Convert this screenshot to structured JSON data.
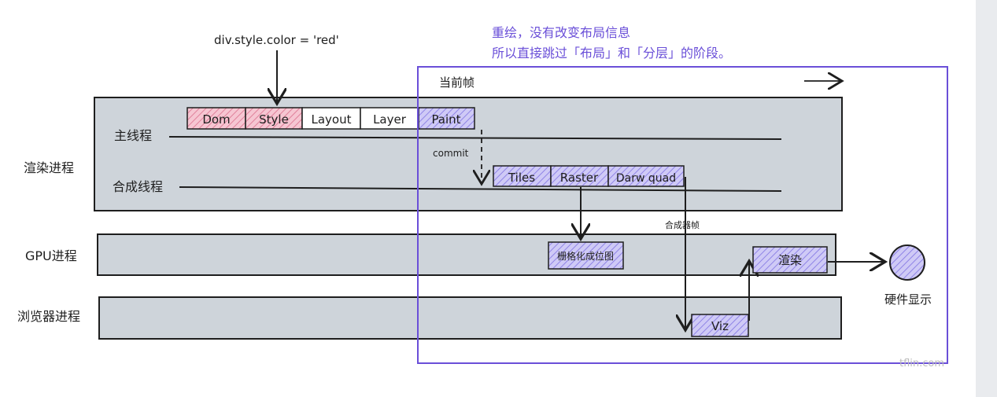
{
  "colors": {
    "lane_fill": "#ced4da",
    "purple": "#6a4fd8",
    "purple_fill": "#b7b0ef",
    "red_fill": "#f1a4b6",
    "stroke": "#1e1e1e"
  },
  "annotations": {
    "code": "div.style.color = 'red'",
    "note_line1": "重绘，没有改变布局信息",
    "note_line2": "所以直接跳过「布局」和「分层」的阶段。",
    "current_frame": "当前帧",
    "commit": "commit",
    "compositor_frame": "合成器帧",
    "hardware_display": "硬件显示",
    "watermark": "tflin.com"
  },
  "lanes": {
    "render_process": "渲染进程",
    "main_thread": "主线程",
    "compositor_thread": "合成线程",
    "gpu_process": "GPU进程",
    "browser_process": "浏览器进程"
  },
  "main_stages": [
    "Dom",
    "Style",
    "Layout",
    "Layer",
    "Paint"
  ],
  "compositor_stages": [
    "Tiles",
    "Raster",
    "Darw quad"
  ],
  "gpu_stages": {
    "raster": "栅格化成位图",
    "render": "渲染"
  },
  "browser_stages": {
    "viz": "Viz"
  }
}
